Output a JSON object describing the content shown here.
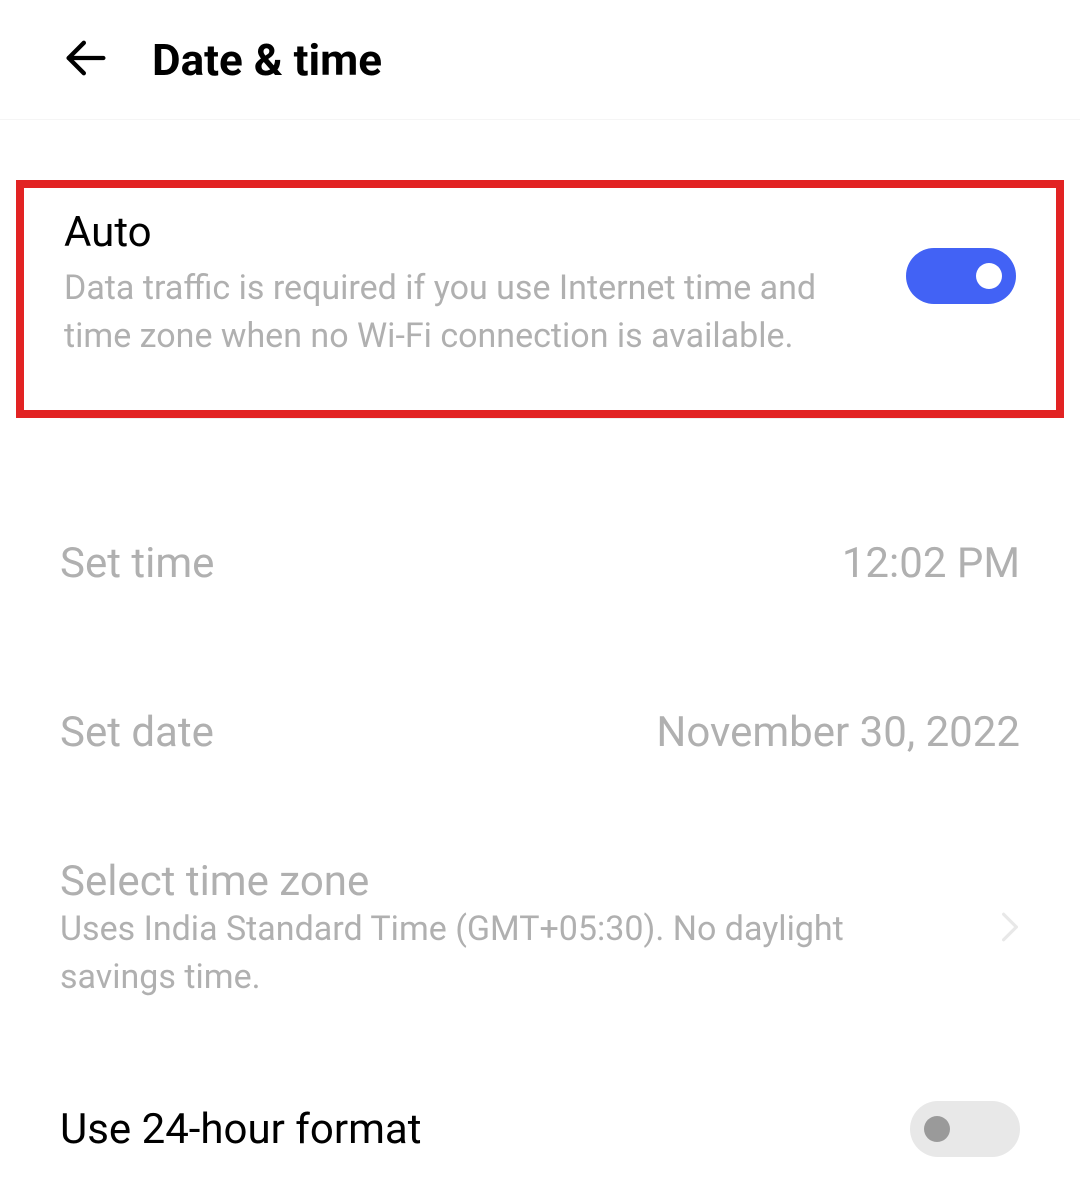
{
  "header": {
    "title": "Date & time"
  },
  "auto": {
    "title": "Auto",
    "subtitle": "Data traffic is required if you use Internet time and time zone when no Wi-Fi connection is available.",
    "enabled": true
  },
  "set_time": {
    "label": "Set time",
    "value": "12:02 PM"
  },
  "set_date": {
    "label": "Set date",
    "value": "November 30, 2022"
  },
  "timezone": {
    "label": "Select time zone",
    "subtitle": "Uses India Standard Time (GMT+05:30). No daylight savings time."
  },
  "format_24h": {
    "label": "Use 24-hour format",
    "enabled": false
  }
}
